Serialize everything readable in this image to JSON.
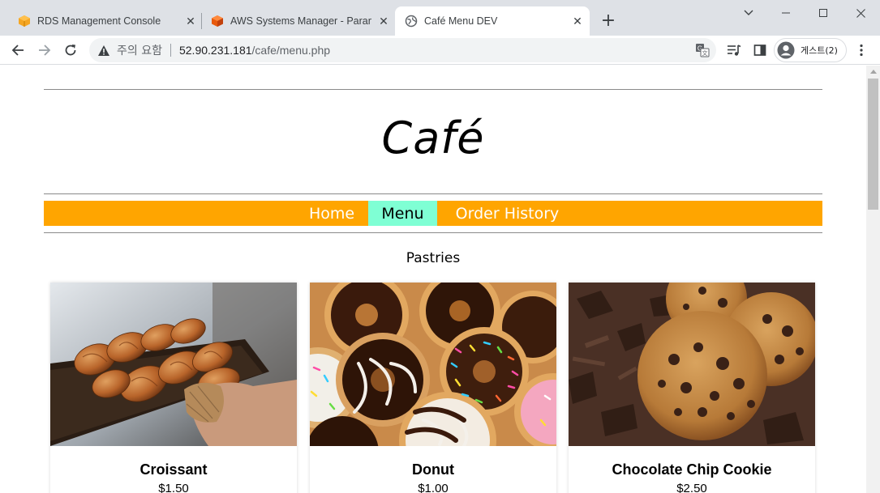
{
  "browser": {
    "tabs": [
      {
        "title": "RDS Management Console",
        "favicon": "rds-cube-icon"
      },
      {
        "title": "AWS Systems Manager - Parame",
        "favicon": "aws-cube-icon"
      },
      {
        "title": "Café Menu DEV",
        "favicon": "globe-icon",
        "active": true
      }
    ],
    "new_tab_label": "+",
    "address": {
      "status": "주의 요함",
      "host": "52.90.231.181",
      "path": "/cafe/menu.php"
    },
    "profile_name": "게스트(2)"
  },
  "site": {
    "logo": "Café",
    "nav": [
      {
        "label": "Home",
        "active": false
      },
      {
        "label": "Menu",
        "active": true
      },
      {
        "label": "Order History",
        "active": false
      }
    ],
    "section_title": "Pastries",
    "products": [
      {
        "name": "Croissant",
        "price": "$1.50",
        "image": "croissant-photo"
      },
      {
        "name": "Donut",
        "price": "$1.00",
        "image": "donut-photo"
      },
      {
        "name": "Chocolate Chip Cookie",
        "price": "$2.50",
        "image": "cookie-photo"
      }
    ]
  },
  "colors": {
    "navbar": "#ffa500",
    "active_nav": "#7fffd4",
    "tabstrip": "#dee1e6"
  }
}
